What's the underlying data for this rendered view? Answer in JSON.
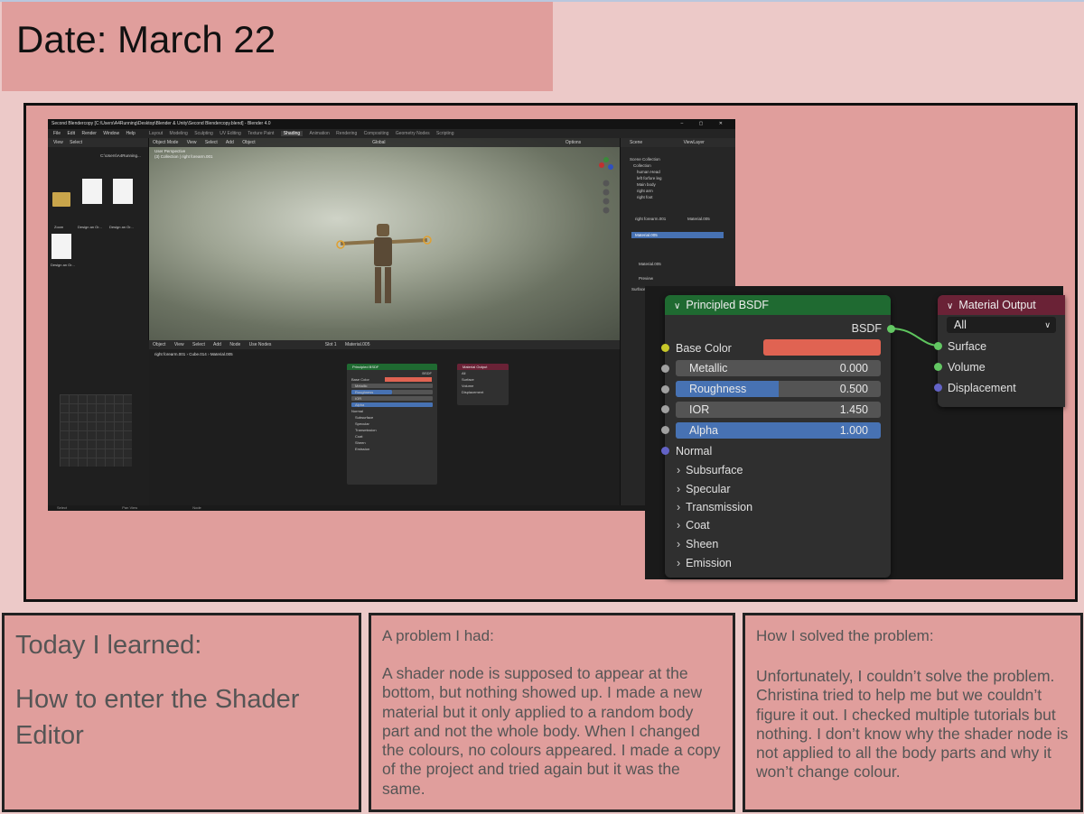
{
  "header": {
    "date": "Date: March 22"
  },
  "blender": {
    "title_bar": "Second Blendercopy [C:\\Users\\A4Running\\Desktop\\Blender & Unity\\Second Blendercopy.blend] - Blender 4.0",
    "menu": [
      "File",
      "Edit",
      "Render",
      "Window",
      "Help"
    ],
    "workspaces": [
      "Layout",
      "Modeling",
      "Sculpting",
      "UV Editing",
      "Texture Paint",
      "Shading",
      "Animation",
      "Rendering",
      "Compositing",
      "Geometry Nodes",
      "Scripting"
    ],
    "active_workspace": "Shading",
    "file_browser": {
      "menu": [
        "View",
        "Select"
      ],
      "path": "C:\\Users\\A4Running...",
      "items": [
        "Zoom",
        "Design an Or...",
        "Design an Or...",
        "Design an Or..."
      ]
    },
    "viewport": {
      "mode": "Object Mode",
      "menu": [
        "View",
        "Select",
        "Add",
        "Object"
      ],
      "transform": "Global",
      "options": "Options",
      "info_line1": "User Perspective",
      "info_line2": "(3) Collection | right forearm.001"
    },
    "outliner": {
      "scene": "Scene",
      "view_layer": "ViewLayer",
      "items": [
        "Scene Collection",
        "Collection",
        "human Head",
        "left forfore leg",
        "Main body",
        "right arm",
        "right foot"
      ]
    },
    "properties": {
      "object": "right forearm.001",
      "material": "Material.005",
      "slot_material": "Material.005",
      "sections": [
        "Preview",
        "Surface"
      ]
    },
    "node_editor": {
      "header": [
        "Object",
        "View",
        "Select",
        "Add",
        "Node"
      ],
      "use_nodes": "Use Nodes",
      "slot": "Slot 1",
      "material": "Material.005",
      "breadcrumb": [
        "right forearm.001",
        "Cube.014",
        "Material.005"
      ]
    },
    "status": [
      "Select",
      "Pan View",
      "Node"
    ]
  },
  "node_zoom": {
    "principled": {
      "title": "Principled BSDF",
      "output": "BSDF",
      "base_color_label": "Base Color",
      "base_color": "#e06352",
      "props": [
        {
          "label": "Metallic",
          "value": "0.000",
          "fill": 0.0,
          "style": "grey"
        },
        {
          "label": "Roughness",
          "value": "0.500",
          "fill": 0.5,
          "style": "blue"
        },
        {
          "label": "IOR",
          "value": "1.450",
          "fill": 0.0,
          "style": "grey"
        },
        {
          "label": "Alpha",
          "value": "1.000",
          "fill": 1.0,
          "style": "blue"
        }
      ],
      "normal": "Normal",
      "panels": [
        "Subsurface",
        "Specular",
        "Transmission",
        "Coat",
        "Sheen",
        "Emission"
      ]
    },
    "output": {
      "title": "Material Output",
      "target": "All",
      "inputs": [
        "Surface",
        "Volume",
        "Displacement"
      ]
    }
  },
  "panels": {
    "learned": {
      "heading": "Today I learned:",
      "body": "How to enter the Shader Editor"
    },
    "problem": {
      "heading": "A problem I had:",
      "body": "A shader node is supposed to appear at the bottom, but nothing showed up. I made a new material but it only applied to a random body part and not the whole body. When I changed the colours, no colours appeared. I made a copy of the project and tried again but it was the same."
    },
    "solution": {
      "heading": "How I solved the problem:",
      "body": "Unfortunately, I couldn’t solve the problem. Christina tried to help me but we couldn’t figure it out. I checked multiple tutorials but nothing. I don’t know why the shader node is not applied to all the body parts and why it won’t change colour."
    }
  },
  "colors": {
    "page_bg": "#ecc9c8",
    "panel_bg": "#e09e9c",
    "node_principled_header": "#1f6a31",
    "node_output_header": "#6a2236",
    "blue_slider": "#4772b3"
  }
}
